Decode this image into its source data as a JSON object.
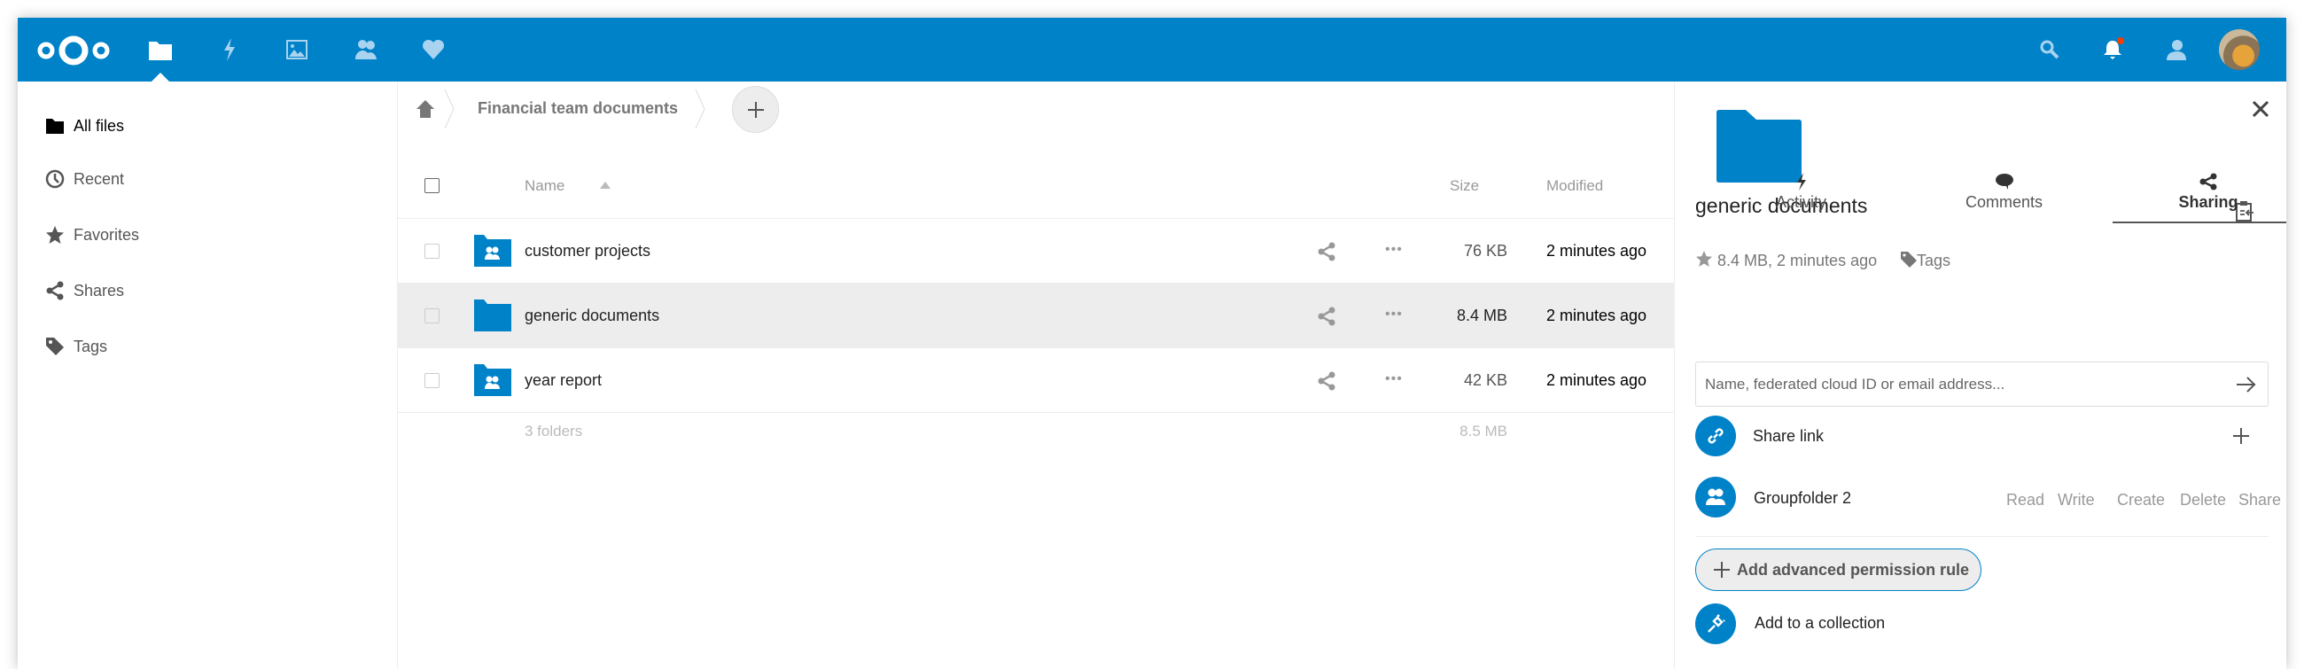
{
  "topbar": {
    "apps": [
      "files",
      "activity",
      "gallery",
      "contacts",
      "favorites"
    ],
    "right_icons": [
      "search",
      "notifications",
      "contacts-menu",
      "user-avatar"
    ],
    "brand_color": "#0082c9",
    "notification_color": "#f23f00"
  },
  "sidebar": {
    "items": [
      {
        "label": "All files",
        "icon": "folder"
      },
      {
        "label": "Recent",
        "icon": "clock"
      },
      {
        "label": "Favorites",
        "icon": "star"
      },
      {
        "label": "Shares",
        "icon": "share"
      },
      {
        "label": "Tags",
        "icon": "tag"
      }
    ]
  },
  "breadcrumb": {
    "items": [
      "Financial team documents"
    ]
  },
  "table": {
    "headers": {
      "name": "Name",
      "size": "Size",
      "modified": "Modified"
    },
    "rows": [
      {
        "name": "customer projects",
        "size": "76 KB",
        "modified": "2 minutes ago",
        "type": "group-folder"
      },
      {
        "name": "generic documents",
        "size": "8.4 MB",
        "modified": "2 minutes ago",
        "type": "folder",
        "selected": true
      },
      {
        "name": "year report",
        "size": "42 KB",
        "modified": "2 minutes ago",
        "type": "group-folder"
      }
    ],
    "summary": {
      "count": "3 folders",
      "size": "8.5 MB"
    }
  },
  "details": {
    "title": "generic documents",
    "meta": "8.4 MB, 2 minutes ago",
    "tags": "Tags",
    "tabs": [
      {
        "label": "Activity"
      },
      {
        "label": "Comments"
      },
      {
        "label": "Sharing",
        "active": true
      }
    ],
    "share_input_placeholder": "Name, federated cloud ID or email address...",
    "share_link": "Share link",
    "group": {
      "name": "Groupfolder 2",
      "permissions": [
        "Read",
        "Write",
        "Create",
        "Delete",
        "Share"
      ]
    },
    "advanced_button": "Add advanced permission rule",
    "collection": "Add to a collection"
  }
}
